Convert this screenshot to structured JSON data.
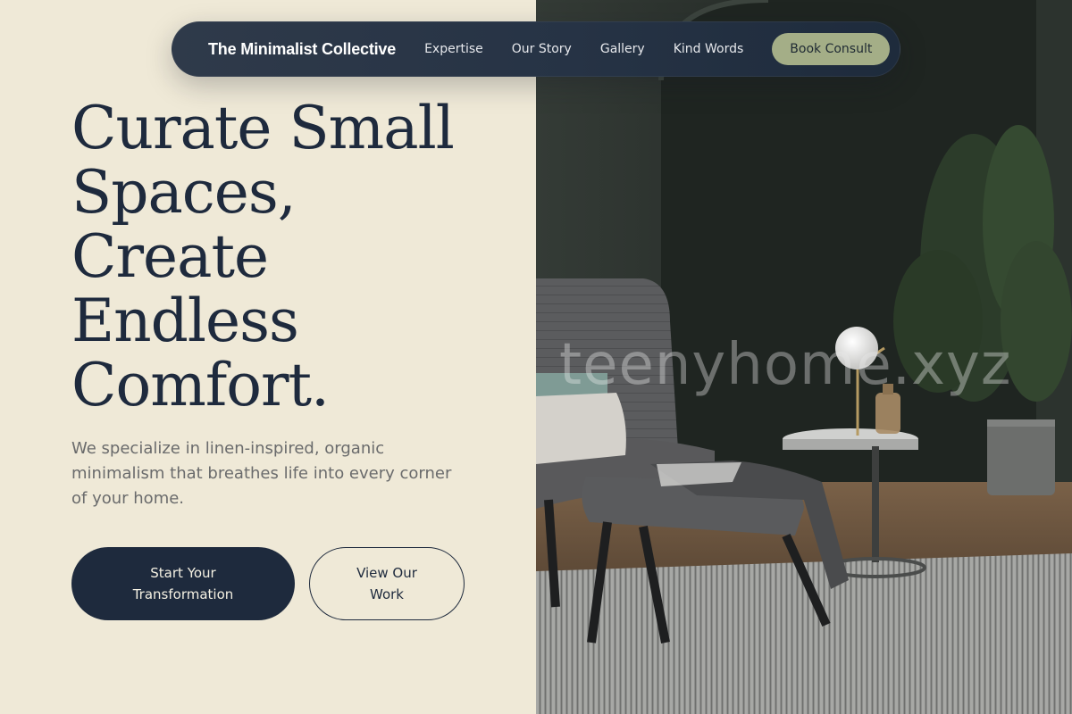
{
  "nav": {
    "brand": "The Minimalist Collective",
    "links": [
      "Expertise",
      "Our Story",
      "Gallery",
      "Kind Words"
    ],
    "cta": "Book Consult"
  },
  "hero": {
    "title_lines": [
      "Curate Small",
      "Spaces,",
      "Create",
      "Endless",
      "Comfort."
    ],
    "subtitle": "We specialize in linen-inspired, organic minimalism that breathes life into every corner of your home.",
    "primary_button": "Start Your Transformation",
    "secondary_button": "View Our Work"
  },
  "image": {
    "watermark": "teenyhome.xyz"
  },
  "colors": {
    "background": "#efe9d7",
    "navy": "#1e2a3d",
    "accent_sage": "#a4ae87"
  }
}
